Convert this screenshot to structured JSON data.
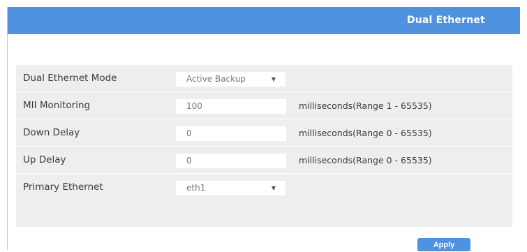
{
  "header": {
    "title": "Dual Ethernet"
  },
  "settings": {
    "mode": {
      "label": "Dual Ethernet Mode",
      "value": "Active Backup"
    },
    "mii": {
      "label": "MII Monitoring",
      "value": "100",
      "hint": "milliseconds(Range 1 - 65535)"
    },
    "down_delay": {
      "label": "Down Delay",
      "value": "0",
      "hint": "milliseconds(Range 0 - 65535)"
    },
    "up_delay": {
      "label": "Up Delay",
      "value": "0",
      "hint": "milliseconds(Range 0 - 65535)"
    },
    "primary": {
      "label": "Primary Ethernet",
      "value": "eth1"
    }
  },
  "actions": {
    "apply_label": "Apply"
  },
  "colors": {
    "accent": "#4f92df",
    "row_bg": "#eeeeee"
  },
  "icons": {
    "dropdown": "triangle-down-icon"
  }
}
